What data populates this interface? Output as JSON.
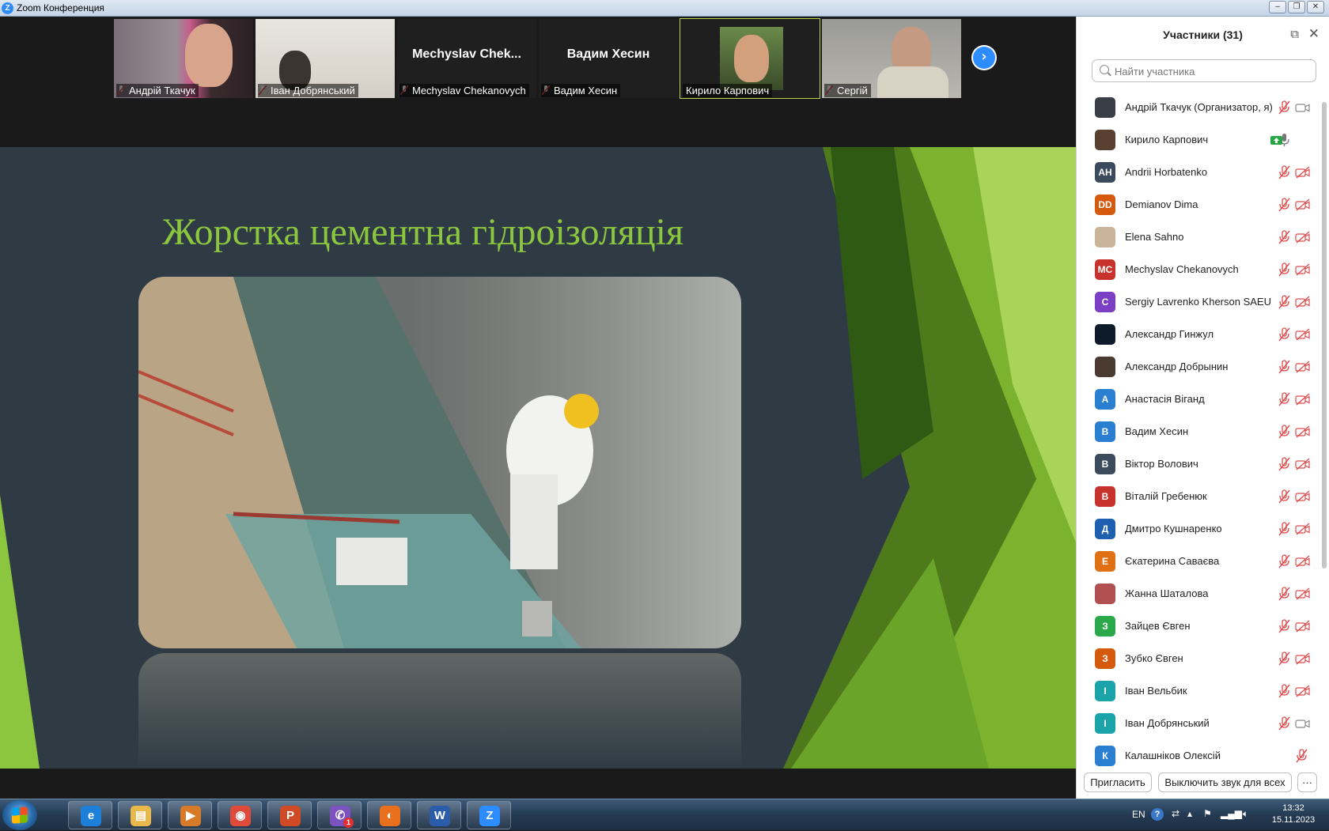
{
  "window": {
    "title": "Zoom Конференция",
    "logo_letter": "Z",
    "controls": [
      "–",
      "❐",
      "✕"
    ]
  },
  "thumbnails": [
    {
      "name": "Андрій Ткачук",
      "muted": true,
      "type": "video"
    },
    {
      "name": "Іван Добрянський",
      "muted": true,
      "type": "video"
    },
    {
      "name": "Mechyslav Chekanovych",
      "big_label": "Mechyslav  Chek...",
      "muted": true,
      "type": "text"
    },
    {
      "name": "Вадим Хесин",
      "big_label": "Вадим Хесин",
      "muted": true,
      "type": "text"
    },
    {
      "name": "Кирило Карпович",
      "muted": false,
      "type": "video",
      "active": true
    },
    {
      "name": "Сергій",
      "muted": true,
      "type": "video"
    }
  ],
  "next_arrow": "›",
  "slide": {
    "title": "Жорстка цементна гідроізоляція"
  },
  "panel": {
    "title": "Участники (31)",
    "search_placeholder": "Найти участника",
    "participants": [
      {
        "name": "Андрій Ткачук (Организатор, я)",
        "avatar": "",
        "color": "#3a3f47",
        "photo": true,
        "mic": "muted",
        "cam": "on"
      },
      {
        "name": "Кирило Карпович",
        "avatar": "",
        "color": "#5a4030",
        "photo": true,
        "mic": "on",
        "cam": "share"
      },
      {
        "name": "Andrii Horbatenko",
        "avatar": "AH",
        "color": "#3b4a5c",
        "mic": "muted",
        "cam": "off"
      },
      {
        "name": "Demianov Dima",
        "avatar": "DD",
        "color": "#d55a0e",
        "mic": "muted",
        "cam": "off"
      },
      {
        "name": "Elena Sahno",
        "avatar": "",
        "color": "#c9b49a",
        "photo": true,
        "mic": "muted",
        "cam": "off"
      },
      {
        "name": "Mechyslav Chekanovych",
        "avatar": "MC",
        "color": "#c8322d",
        "mic": "muted",
        "cam": "off"
      },
      {
        "name": "Sergiy Lavrenko Kherson SAEU",
        "avatar": "C",
        "color": "#7b3fc4",
        "mic": "muted",
        "cam": "off"
      },
      {
        "name": "Александр Гинжул",
        "avatar": "",
        "color": "#0d1b2a",
        "photo": true,
        "mic": "muted",
        "cam": "off"
      },
      {
        "name": "Александр Добрынин",
        "avatar": "",
        "color": "#4a3a30",
        "photo": true,
        "mic": "muted",
        "cam": "off"
      },
      {
        "name": "Анастасія Віганд",
        "avatar": "А",
        "color": "#2b7fd0",
        "mic": "muted",
        "cam": "off"
      },
      {
        "name": "Вадим Хесин",
        "avatar": "В",
        "color": "#2b7fd0",
        "mic": "muted",
        "cam": "off"
      },
      {
        "name": "Віктор Волович",
        "avatar": "В",
        "color": "#3b4a5c",
        "mic": "muted",
        "cam": "off"
      },
      {
        "name": "Віталій Гребенюк",
        "avatar": "В",
        "color": "#c8322d",
        "mic": "muted",
        "cam": "off"
      },
      {
        "name": "Дмитро Кушнаренко",
        "avatar": "Д",
        "color": "#1f5fb0",
        "mic": "muted",
        "cam": "off"
      },
      {
        "name": "Єкатерина Саваєва",
        "avatar": "Е",
        "color": "#e07014",
        "mic": "muted",
        "cam": "off"
      },
      {
        "name": "Жанна Шаталова",
        "avatar": "",
        "color": "#b05050",
        "photo": true,
        "mic": "muted",
        "cam": "off"
      },
      {
        "name": "Зайцев Євген",
        "avatar": "З",
        "color": "#2aa84a",
        "mic": "muted",
        "cam": "off"
      },
      {
        "name": "Зубко Євген",
        "avatar": "З",
        "color": "#d55a0e",
        "mic": "muted",
        "cam": "off"
      },
      {
        "name": "Іван Вельбик",
        "avatar": "І",
        "color": "#1aa3a8",
        "mic": "muted",
        "cam": "off"
      },
      {
        "name": "Іван Добрянський",
        "avatar": "І",
        "color": "#1aa3a8",
        "mic": "muted",
        "cam": "on"
      },
      {
        "name": "Калашніков Олексій",
        "avatar": "К",
        "color": "#2b7fd0",
        "mic": "none",
        "cam": "off"
      }
    ],
    "footer": {
      "invite": "Пригласить",
      "mute_all": "Выключить звук для всех",
      "more": "···"
    }
  },
  "taskbar": {
    "apps": [
      {
        "icon": "ie-icon",
        "letter": "e",
        "color": "#1e7fd8"
      },
      {
        "icon": "explorer-icon",
        "letter": "▤",
        "color": "#e8b84a"
      },
      {
        "icon": "media-player-icon",
        "letter": "▶",
        "color": "#d77a2a"
      },
      {
        "icon": "chrome-icon",
        "letter": "◉",
        "color": "#e04a3a"
      },
      {
        "icon": "powerpoint-icon",
        "letter": "P",
        "color": "#d04a26"
      },
      {
        "icon": "viber-icon",
        "letter": "✆",
        "color": "#7b52c0",
        "badge": "1"
      },
      {
        "icon": "firefox-icon",
        "letter": "◐",
        "color": "#e8701c"
      },
      {
        "icon": "word-icon",
        "letter": "W",
        "color": "#2b5caa"
      },
      {
        "icon": "zoom-icon",
        "letter": "Z",
        "color": "#2d8cff"
      }
    ],
    "tray": {
      "lang": "EN",
      "help": "?",
      "time": "13:32",
      "date": "15.11.2023"
    }
  },
  "colors": {
    "slide_bg": "#2f3b44",
    "slide_title": "#8cc63f",
    "muted_red": "#e04a4a",
    "zoom_blue": "#2d8cff"
  }
}
